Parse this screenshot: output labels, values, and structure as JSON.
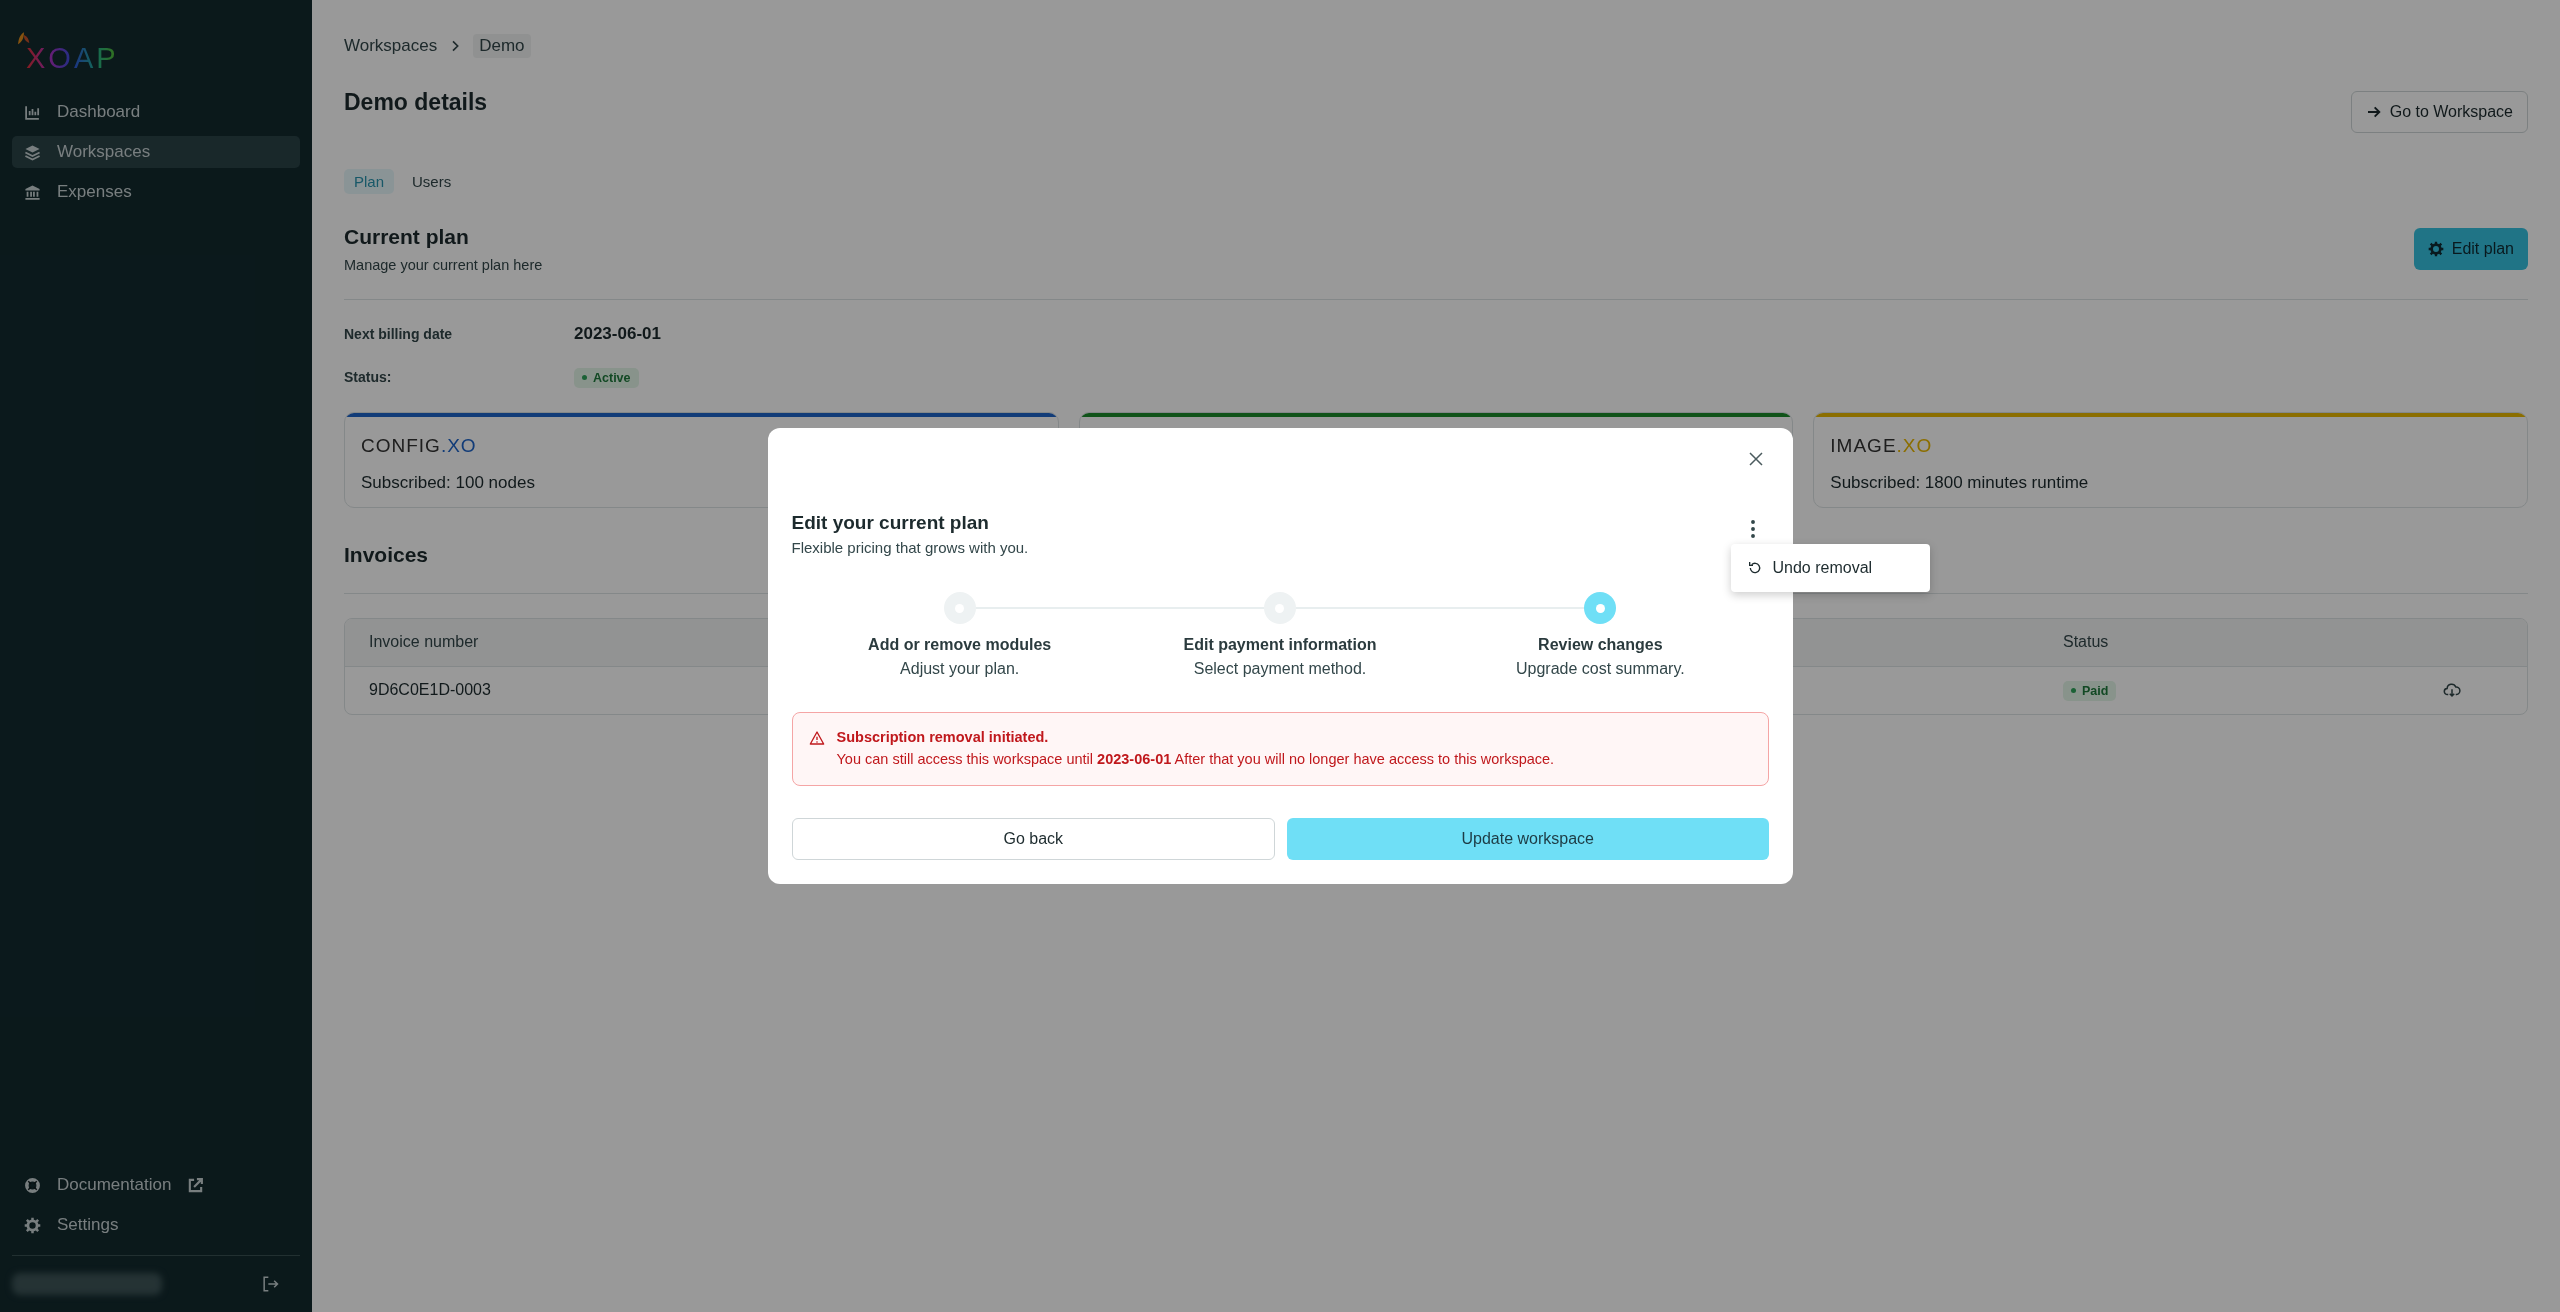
{
  "sidebar": {
    "logo": "XOAP",
    "items": [
      {
        "label": "Dashboard",
        "selected": false
      },
      {
        "label": "Workspaces",
        "selected": true
      },
      {
        "label": "Expenses",
        "selected": false
      }
    ],
    "bottom_items": [
      {
        "label": "Documentation"
      },
      {
        "label": "Settings"
      }
    ]
  },
  "breadcrumb": [
    "Workspaces",
    "Demo"
  ],
  "page_title": "Demo details",
  "go_button": "Go to Workspace",
  "tabs": [
    {
      "label": "Plan",
      "selected": true
    },
    {
      "label": "Users",
      "selected": false
    }
  ],
  "plan": {
    "title": "Current plan",
    "subtitle": "Manage your current plan here",
    "edit_button": "Edit plan",
    "fields": [
      {
        "label": "Next billing date",
        "value": "2023-06-01",
        "kind": "text"
      },
      {
        "label": "Status:",
        "value": "Active",
        "kind": "badge"
      }
    ]
  },
  "modules": [
    {
      "color": "#123c78",
      "logo": "CONFIG",
      "logo_suffix": ".XO",
      "subscribed": "Subscribed: 100 nodes"
    },
    {
      "color": "#105319"
    },
    {
      "color": "#8b6e00",
      "logo": "IMAGE",
      "logo_suffix": ".XO",
      "subscribed": "Subscribed: 1800 minutes runtime"
    }
  ],
  "invoices": {
    "title": "Invoices",
    "columns": [
      "Invoice number",
      "Status"
    ],
    "rows": [
      {
        "number": "9D6C0E1D-0003",
        "status": "Paid"
      }
    ]
  },
  "modal": {
    "title": "Edit your current plan",
    "subtitle": "Flexible pricing that grows with you.",
    "menu": [
      {
        "label": "Undo removal"
      }
    ],
    "steps": [
      {
        "title": "Add or remove modules",
        "subtitle": "Adjust your plan.",
        "selected": false
      },
      {
        "title": "Edit payment information",
        "subtitle": "Select payment method.",
        "selected": false
      },
      {
        "title": "Review changes",
        "subtitle": "Upgrade cost summary.",
        "selected": true
      }
    ],
    "alert": {
      "title": "Subscription removal initiated.",
      "text": "You can still access this workspace until **2023-06-01** After that you will no longer have access to this workspace."
    },
    "back_button": "Go back",
    "submit_button": "Update workspace"
  }
}
